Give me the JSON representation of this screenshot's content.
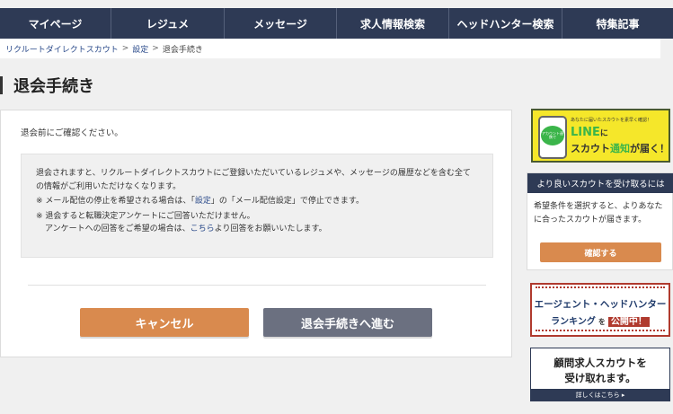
{
  "nav": {
    "items": [
      "マイページ",
      "レジュメ",
      "メッセージ",
      "求人情報検索",
      "ヘッドハンター検索",
      "特集記事"
    ]
  },
  "breadcrumb": {
    "home": "リクルートダイレクトスカウト",
    "sep1": ">",
    "settings": "設定",
    "sep2": ">",
    "current": "退会手続き"
  },
  "page": {
    "title": "退会手続き",
    "intro": "退会前にご確認ください。",
    "notice": {
      "p1": "退会されますと、リクルートダイレクトスカウトにご登録いただいているレジュメや、メッセージの履歴などを含む全ての情報がご利用いただけなくなります。",
      "p2_pre": "※ メール配信の停止を希望される場合は、「",
      "p2_link": "設定",
      "p2_post": "」の「メール配信設定」で停止できます。",
      "p3": "※ 退会すると転職決定アンケートにご回答いただけません。",
      "p4_pre": "アンケートへの回答をご希望の場合は、",
      "p4_link": "こちら",
      "p4_post": "より回答をお願いいたします。"
    },
    "cancel_label": "キャンセル",
    "proceed_label": "退会手続きへ進む"
  },
  "sidebar": {
    "line_ad": {
      "small": "あなたに届いたスカウトを素早く確認！",
      "bubble": "アカウント連携で",
      "line": "LINE",
      "ni": "に",
      "scout": "スカウト",
      "notice": "通知",
      "ga": "が届く！"
    },
    "scout_box": {
      "heading": "より良いスカウトを受け取るには",
      "text": "希望条件を選択すると、よりあなたに合ったスカウトが届きます。",
      "button": "確認する"
    },
    "agent_ad": {
      "line1": "エージェント・ヘッドハンター",
      "line2a": "ランキング",
      "line2b": "を",
      "badge": "公開中！"
    },
    "komon_ad": {
      "line1": "顧問求人スカウトを",
      "line2": "受け取れます。",
      "foot": "詳しくはこちら ▸"
    }
  }
}
